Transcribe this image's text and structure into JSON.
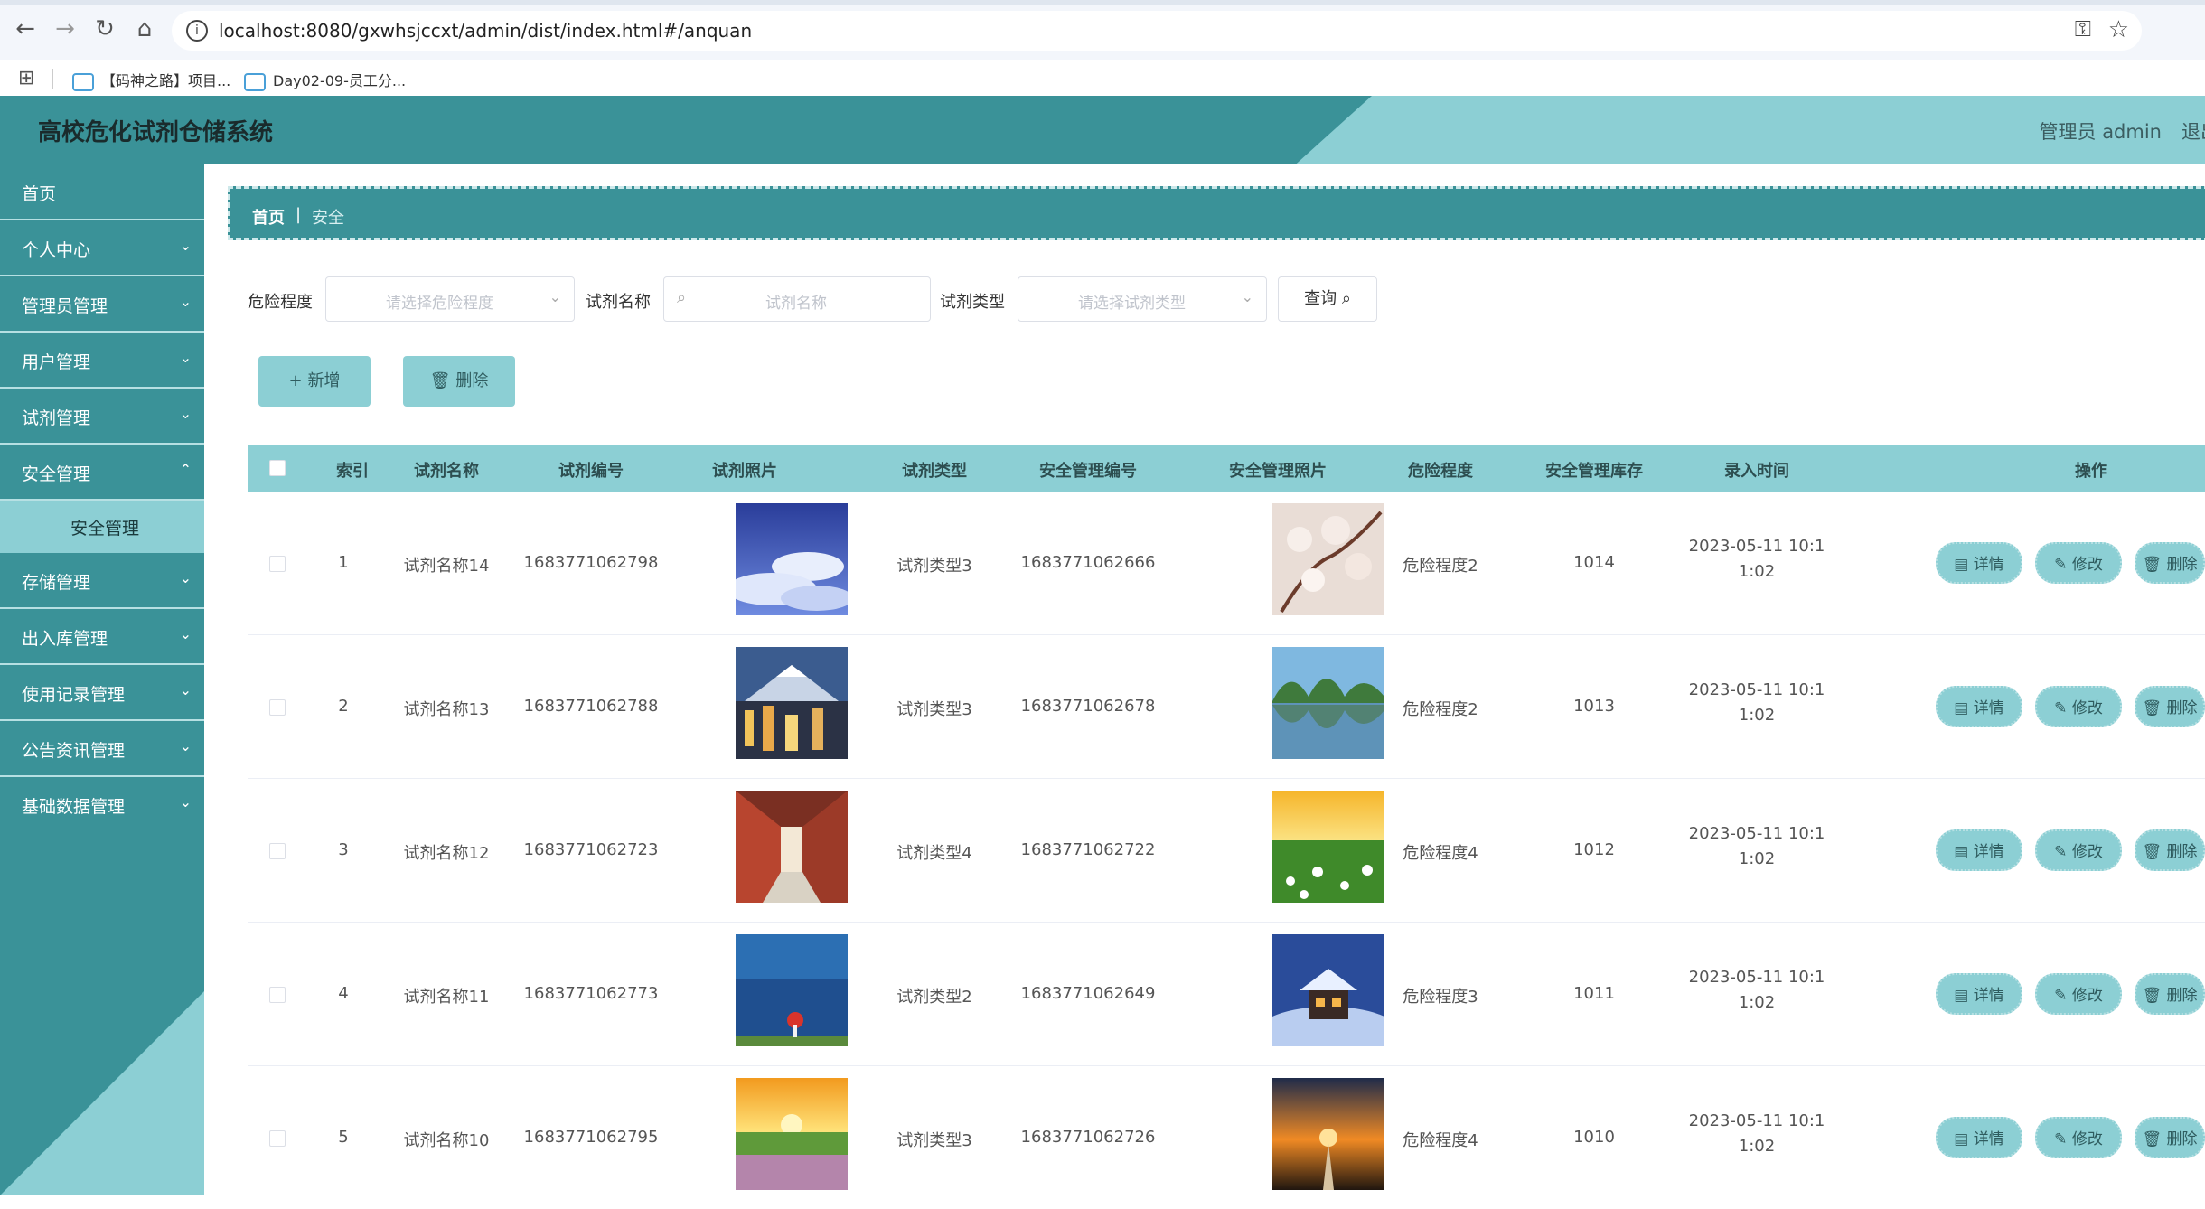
{
  "browser": {
    "url": "localhost:8080/gxwhsjccxt/admin/dist/index.html#/anquan",
    "bookmarks": [
      "【码神之路】项目...",
      "Day02-09-员工分..."
    ]
  },
  "header": {
    "title": "高校危化试剂仓储系统",
    "admin_label": "管理员 admin",
    "logout_label": "退出"
  },
  "sidebar": {
    "items": [
      {
        "label": "首页"
      },
      {
        "label": "个人中心"
      },
      {
        "label": "管理员管理"
      },
      {
        "label": "用户管理"
      },
      {
        "label": "试剂管理"
      },
      {
        "label": "安全管理"
      },
      {
        "label": "存储管理"
      },
      {
        "label": "出入库管理"
      },
      {
        "label": "使用记录管理"
      },
      {
        "label": "公告资讯管理"
      },
      {
        "label": "基础数据管理"
      }
    ],
    "sub_item": "安全管理"
  },
  "breadcrumb": {
    "home": "首页",
    "sep": "|",
    "current": "安全"
  },
  "filters": {
    "danger_label": "危险程度",
    "danger_placeholder": "请选择危险程度",
    "name_label": "试剂名称",
    "name_placeholder": "试剂名称",
    "type_label": "试剂类型",
    "type_placeholder": "请选择试剂类型",
    "query_label": "查询"
  },
  "actions": {
    "add_label": "新增",
    "delete_label": "删除"
  },
  "table": {
    "columns": [
      "索引",
      "试剂名称",
      "试剂编号",
      "试剂照片",
      "试剂类型",
      "安全管理编号",
      "安全管理照片",
      "危险程度",
      "安全管理库存",
      "录入时间",
      "操作"
    ],
    "op_labels": {
      "detail": "详情",
      "edit": "修改",
      "delete": "删除"
    },
    "rows": [
      {
        "index": "1",
        "name": "试剂名称14",
        "code": "1683771062798",
        "type": "试剂类型3",
        "safety_code": "1683771062666",
        "danger": "危险程度2",
        "stock": "1014",
        "time_line1": "2023-05-11 10:1",
        "time_line2": "1:02"
      },
      {
        "index": "2",
        "name": "试剂名称13",
        "code": "1683771062788",
        "type": "试剂类型3",
        "safety_code": "1683771062678",
        "danger": "危险程度2",
        "stock": "1013",
        "time_line1": "2023-05-11 10:1",
        "time_line2": "1:02"
      },
      {
        "index": "3",
        "name": "试剂名称12",
        "code": "1683771062723",
        "type": "试剂类型4",
        "safety_code": "1683771062722",
        "danger": "危险程度4",
        "stock": "1012",
        "time_line1": "2023-05-11 10:1",
        "time_line2": "1:02"
      },
      {
        "index": "4",
        "name": "试剂名称11",
        "code": "1683771062773",
        "type": "试剂类型2",
        "safety_code": "1683771062649",
        "danger": "危险程度3",
        "stock": "1011",
        "time_line1": "2023-05-11 10:1",
        "time_line2": "1:02"
      },
      {
        "index": "5",
        "name": "试剂名称10",
        "code": "1683771062795",
        "type": "试剂类型3",
        "safety_code": "1683771062726",
        "danger": "危险程度4",
        "stock": "1010",
        "time_line1": "2023-05-11 10:1",
        "time_line2": "1:02"
      }
    ]
  },
  "colors": {
    "primary": "#3a9298",
    "light": "#8ccfd4"
  }
}
